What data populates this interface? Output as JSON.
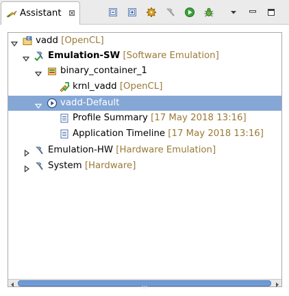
{
  "view": {
    "tab_title": "Assistant",
    "tab_close_glyph": "⊠",
    "icons": [
      "assistant-icon",
      "collapse-all-icon",
      "expand-all-icon",
      "settings-gear-icon",
      "build-hammer-icon",
      "run-icon",
      "debug-icon",
      "view-menu-icon",
      "minimize-icon",
      "maximize-icon"
    ]
  },
  "tree": [
    {
      "label": "vadd",
      "decoration": "[OpenCL]",
      "bold": false,
      "expanded": true,
      "icon": "project-icon"
    },
    {
      "label": "Emulation-SW",
      "decoration": "[Software Emulation]",
      "bold": true,
      "expanded": true,
      "icon": "build-config-active-icon"
    },
    {
      "label": "binary_container_1",
      "decoration": "",
      "bold": false,
      "expanded": true,
      "icon": "binary-container-icon"
    },
    {
      "label": "krnl_vadd",
      "decoration": "[OpenCL]",
      "bold": false,
      "icon": "kernel-icon"
    },
    {
      "label": "vadd-Default",
      "decoration": "",
      "bold": false,
      "expanded": true,
      "selected": true,
      "icon": "run-config-icon"
    },
    {
      "label": "Profile Summary",
      "decoration": "[17 May 2018 13:16]",
      "bold": false,
      "icon": "report-icon"
    },
    {
      "label": "Application Timeline",
      "decoration": "[17 May 2018 13:16]",
      "bold": false,
      "icon": "report-icon"
    },
    {
      "label": "Emulation-HW",
      "decoration": "[Hardware Emulation]",
      "bold": false,
      "expanded": false,
      "icon": "build-config-icon"
    },
    {
      "label": "System",
      "decoration": "[Hardware]",
      "bold": false,
      "expanded": false,
      "icon": "build-config-icon"
    }
  ],
  "colors": {
    "selection": "#84a7d6",
    "decoration": "#9a7a37",
    "scrollbar_thumb": "#6f9ad4"
  }
}
